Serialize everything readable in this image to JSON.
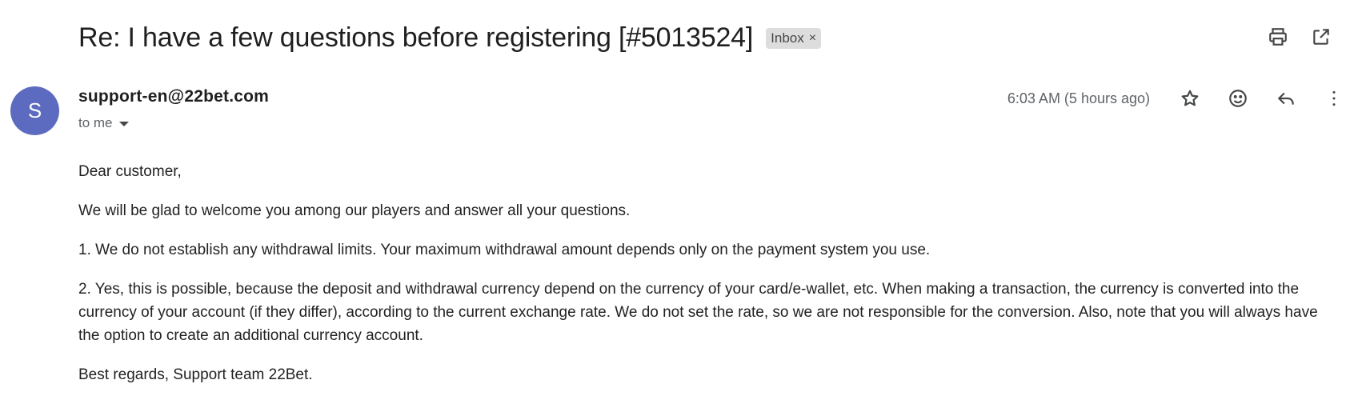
{
  "subject": "Re: I have a few questions before registering [#5013524]",
  "label": {
    "text": "Inbox",
    "remove_glyph": "×"
  },
  "toolbar": {
    "icons": [
      "print-icon",
      "open-in-new-window-icon"
    ]
  },
  "sender": {
    "avatar_letter": "S",
    "avatar_color": "#5c6bc0",
    "email": "support-en@22bet.com",
    "to": "to me"
  },
  "timestamp": "6:03 AM (5 hours ago)",
  "message_actions": {
    "icons": [
      "star-icon",
      "emoji-reaction-icon",
      "reply-icon",
      "more-vert-icon"
    ]
  },
  "body": {
    "greeting": "Dear customer,",
    "paragraphs": [
      "We will be glad to welcome you among our players and answer all your questions.",
      "1. We do not establish any withdrawal limits. Your maximum withdrawal amount depends only on the payment system you use.",
      "2. Yes, this is possible, because the deposit and withdrawal currency depend on the currency of your card/e-wallet, etc. When making a transaction, the currency is converted into the currency of your account (if they differ), according to the current exchange rate. We do not set the rate, so we are not responsible for the conversion. Also, note that you will always have the option to create an additional currency account."
    ],
    "signature": "Best regards, Support team 22Bet."
  }
}
